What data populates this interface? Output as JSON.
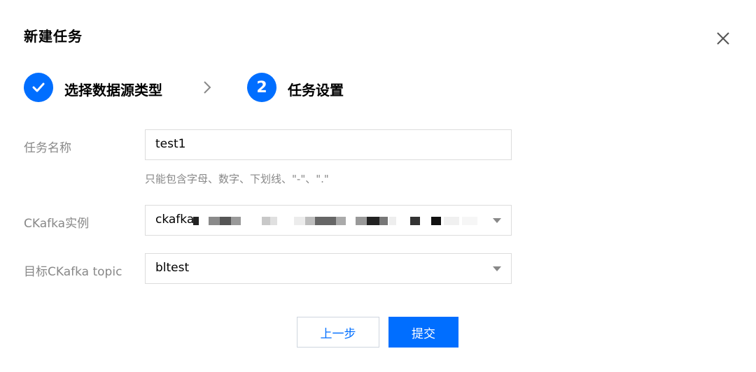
{
  "dialog": {
    "title": "新建任务",
    "close_icon": "close-icon"
  },
  "steps": [
    {
      "label": "选择数据源类型",
      "state": "done",
      "icon": "check-icon"
    },
    {
      "label": "任务设置",
      "state": "active",
      "number": "2"
    }
  ],
  "form": {
    "task_name": {
      "label": "任务名称",
      "value": "test1",
      "hint": "只能包含字母、数字、下划线、\"-\"、\".\""
    },
    "ckafka_instance": {
      "label": "CKafka实例",
      "value": "ckafka"
    },
    "target_topic": {
      "label": "目标CKafka topic",
      "value": "bltest"
    }
  },
  "buttons": {
    "prev": "上一步",
    "submit": "提交"
  },
  "colors": {
    "primary": "#006eff",
    "label": "#888888",
    "border": "#dcdcdc"
  }
}
